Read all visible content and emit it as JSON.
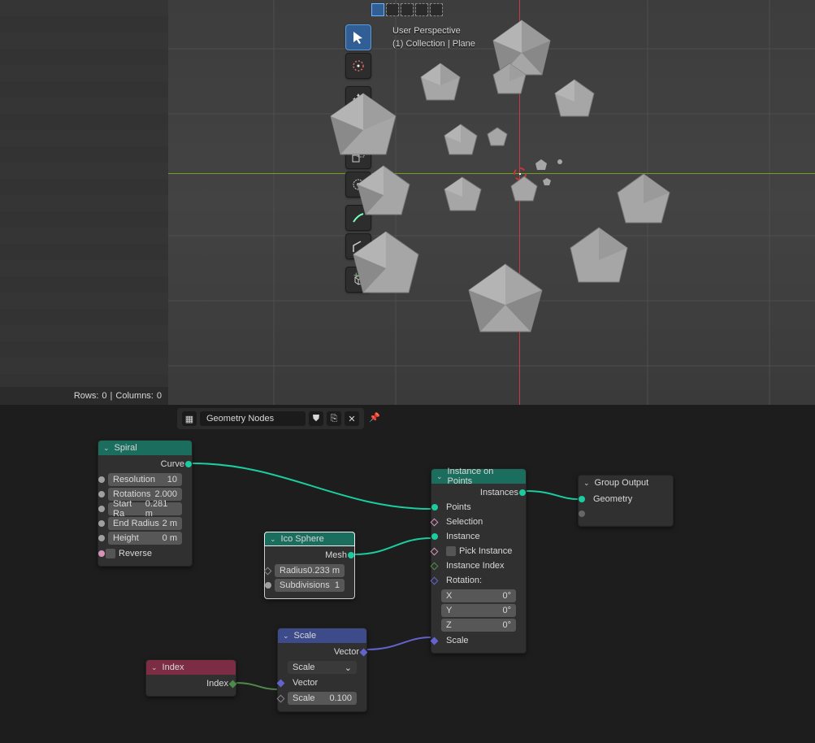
{
  "status": {
    "rows_label": "Rows:",
    "rows_value": "0",
    "sep": "|",
    "cols_label": "Columns:",
    "cols_value": "0"
  },
  "viewport": {
    "info_line1": "User Perspective",
    "info_line2": "(1) Collection | Plane"
  },
  "node_editor": {
    "title": "Geometry Nodes"
  },
  "nodes": {
    "spiral": {
      "title": "Spiral",
      "out": "Curve",
      "fields": [
        {
          "label": "Resolution",
          "value": "10"
        },
        {
          "label": "Rotations",
          "value": "2.000"
        },
        {
          "label": "Start Ra",
          "value": "0.281 m"
        },
        {
          "label": "End Radius",
          "value": "2 m"
        },
        {
          "label": "Height",
          "value": "0 m"
        }
      ],
      "reverse": "Reverse"
    },
    "icosphere": {
      "title": "Ico Sphere",
      "out": "Mesh",
      "fields": [
        {
          "label": "Radius",
          "value": "0.233 m"
        },
        {
          "label": "Subdivisions",
          "value": "1"
        }
      ]
    },
    "index": {
      "title": "Index",
      "out": "Index"
    },
    "scale": {
      "title": "Scale",
      "out": "Vector",
      "mode": "Scale",
      "in_vector": "Vector",
      "scale_label": "Scale",
      "scale_value": "0.100"
    },
    "instance": {
      "title": "Instance on Points",
      "out": "Instances",
      "ins": [
        "Points",
        "Selection",
        "Instance",
        "Pick Instance",
        "Instance Index",
        "Rotation:"
      ],
      "rot": [
        {
          "axis": "X",
          "val": "0°"
        },
        {
          "axis": "Y",
          "val": "0°"
        },
        {
          "axis": "Z",
          "val": "0°"
        }
      ],
      "scale": "Scale"
    },
    "output": {
      "title": "Group Output",
      "in": "Geometry"
    }
  }
}
